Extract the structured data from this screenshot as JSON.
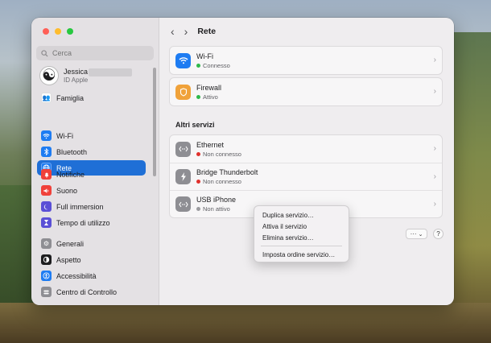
{
  "sidebar": {
    "search_placeholder": "Cerca",
    "user": {
      "name": "Jessica",
      "subtitle": "ID Apple"
    },
    "items": [
      {
        "label": "Famiglia",
        "icon": "family-icon",
        "color": "#e9e6ea"
      },
      {
        "label": "Wi-Fi",
        "icon": "wifi-icon",
        "color": "#1e7cf2"
      },
      {
        "label": "Bluetooth",
        "icon": "bluetooth-icon",
        "color": "#1e7cf2"
      },
      {
        "label": "Rete",
        "icon": "globe-icon",
        "color": "#1e7cf2",
        "selected": true
      },
      {
        "label": "Notifiche",
        "icon": "bell-icon",
        "color": "#f0413a"
      },
      {
        "label": "Suono",
        "icon": "speaker-icon",
        "color": "#f0413a"
      },
      {
        "label": "Full immersion",
        "icon": "moon-icon",
        "color": "#5a4fd6"
      },
      {
        "label": "Tempo di utilizzo",
        "icon": "hourglass-icon",
        "color": "#5a4fd6"
      },
      {
        "label": "Generali",
        "icon": "gear-icon",
        "color": "#8e8e93"
      },
      {
        "label": "Aspetto",
        "icon": "appearance-icon",
        "color": "#1d1d1f"
      },
      {
        "label": "Accessibilità",
        "icon": "accessibility-icon",
        "color": "#1e7cf2"
      },
      {
        "label": "Centro di Controllo",
        "icon": "control-center-icon",
        "color": "#8e8e93"
      }
    ]
  },
  "header": {
    "title": "Rete"
  },
  "services": [
    {
      "name": "Wi-Fi",
      "status": "Connesso",
      "status_color": "#2fb94b",
      "icon": "wifi-icon",
      "icon_color": "#1e7cf2"
    },
    {
      "name": "Firewall",
      "status": "Attivo",
      "status_color": "#2fb94b",
      "icon": "firewall-icon",
      "icon_color": "#f0a23a"
    }
  ],
  "other_services": {
    "title": "Altri servizi",
    "items": [
      {
        "name": "Ethernet",
        "status": "Non connesso",
        "status_color": "#e0312d",
        "icon": "ethernet-icon",
        "icon_color": "#8e8e93"
      },
      {
        "name": "Bridge Thunderbolt",
        "status": "Non connesso",
        "status_color": "#e0312d",
        "icon": "thunderbolt-icon",
        "icon_color": "#8e8e93"
      },
      {
        "name": "USB iPhone",
        "status": "Non attivo",
        "status_color": "#9b9b9f",
        "icon": "ethernet-icon",
        "icon_color": "#8e8e93"
      }
    ]
  },
  "actions": {
    "more_label": "···",
    "help_label": "?"
  },
  "context_menu": {
    "items": [
      "Duplica servizio…",
      "Attiva il servizio",
      "Elimina servizio…"
    ],
    "separator_item": "Imposta ordine servizio…"
  },
  "colors": {
    "accent": "#1f6fd6",
    "close": "#ff5f57",
    "minimize": "#febc2e",
    "zoom": "#28c840"
  }
}
